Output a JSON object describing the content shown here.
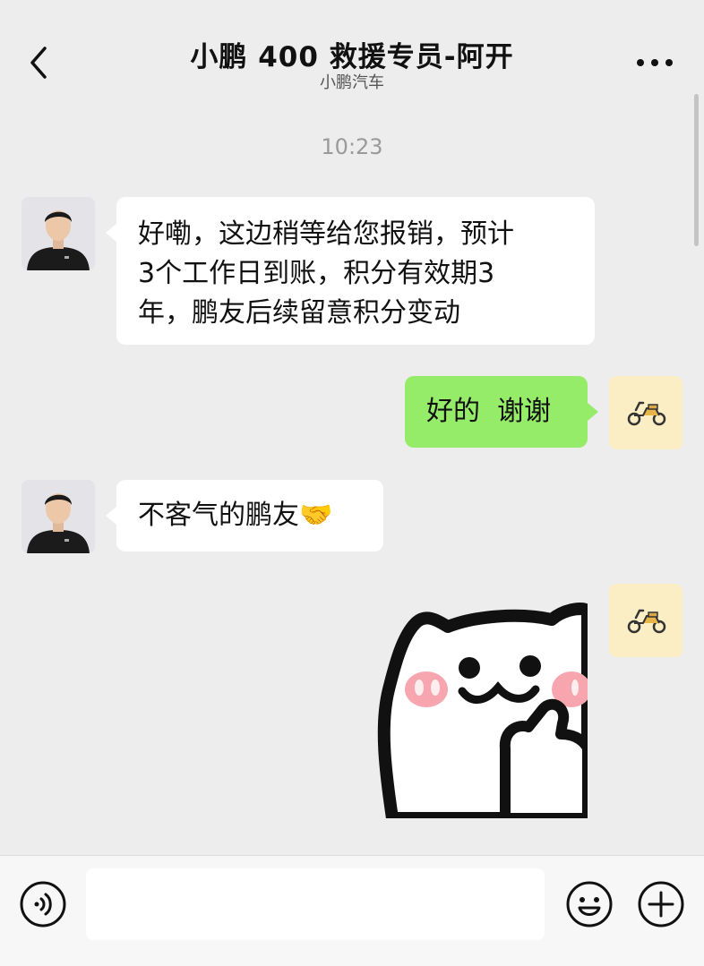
{
  "header": {
    "title": "小鹏 400 救援专员-阿开",
    "subtitle": "小鹏汽车",
    "back_icon": "chevron-left-icon",
    "more_icon": "more-dots-icon"
  },
  "chat": {
    "timestamp": "10:23",
    "messages": [
      {
        "from": "agent",
        "lines": [
          "好嘞，这边稍等给您报销，预计",
          "3个工作日到账，积分有效期3",
          "年，鹏友后续留意积分变动"
        ]
      },
      {
        "from": "me",
        "text": "好的  谢谢"
      },
      {
        "from": "agent",
        "text": "不客气的鹏友🤝"
      },
      {
        "from": "me",
        "sticker": "white-cat-thumbs-up-sticker"
      }
    ]
  },
  "input_bar": {
    "voice_icon": "voice-icon",
    "input_value": "",
    "emoji_icon": "emoji-icon",
    "plus_icon": "plus-icon"
  },
  "colors": {
    "background": "#ededed",
    "green_bubble": "#95ec69",
    "white_bubble": "#ffffff",
    "right_avatar_bg": "#fbedc4"
  }
}
